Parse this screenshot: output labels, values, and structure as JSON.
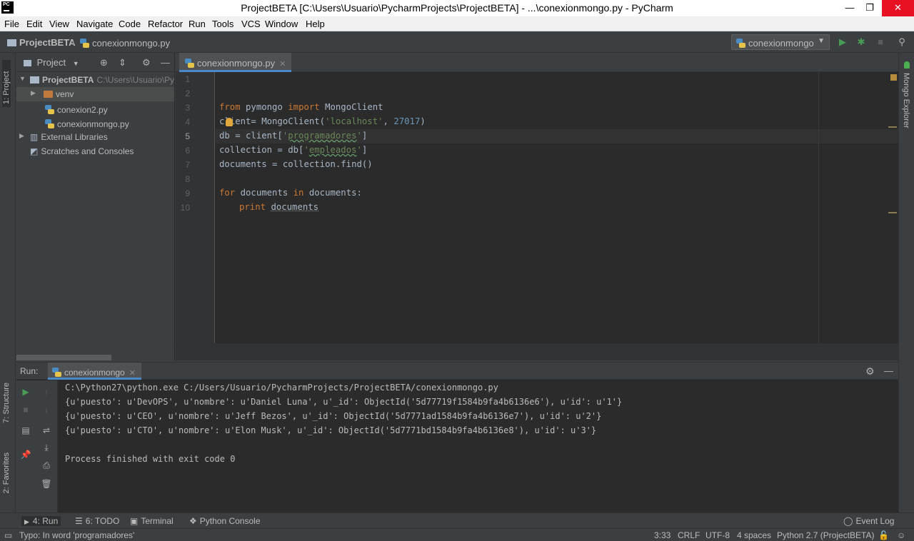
{
  "window": {
    "title": "ProjectBETA [C:\\Users\\Usuario\\PycharmProjects\\ProjectBETA] - ...\\conexionmongo.py - PyCharm",
    "logo_text": "PC",
    "minimize": "—",
    "maximize": "❐",
    "close": "✕"
  },
  "menu": [
    "File",
    "Edit",
    "View",
    "Navigate",
    "Code",
    "Refactor",
    "Run",
    "Tools",
    "VCS",
    "Window",
    "Help"
  ],
  "breadcrumb": {
    "project": "ProjectBETA",
    "file": "conexionmongo.py"
  },
  "run_config": {
    "name": "conexionmongo"
  },
  "left_strip": {
    "project": "1: Project",
    "structure": "7: Structure",
    "favorites": "2: Favorites"
  },
  "right_strip": {
    "mongo": "Mongo Explorer"
  },
  "project_panel": {
    "title": "Project",
    "tree": [
      {
        "label": "ProjectBETA",
        "path": "C:\\Users\\Usuario\\PycharmProjects\\ProjectBETA"
      },
      {
        "label": "venv"
      },
      {
        "label": "conexion2.py"
      },
      {
        "label": "conexionmongo.py"
      },
      {
        "label": "External Libraries"
      },
      {
        "label": "Scratches and Consoles"
      }
    ]
  },
  "editor": {
    "tab": "conexionmongo.py",
    "line_numbers": [
      "1",
      "2",
      "3",
      "4",
      "5",
      "6",
      "7",
      "8",
      "9",
      "10"
    ],
    "code": {
      "l3": {
        "kw1": "from",
        "mod": " pymongo ",
        "kw2": "import",
        "rest": " MongoClient"
      },
      "l4": {
        "a": "client= MongoClient(",
        "s": "'localhost'",
        "b": ", ",
        "n": "27017",
        "c": ")"
      },
      "l5": {
        "a": "db = client[",
        "q1": "'",
        "s": "programadores",
        "q2": "'",
        "c": "]"
      },
      "l6": {
        "a": "collection = db[",
        "q1": "'",
        "s": "empleados",
        "q2": "'",
        "c": "]"
      },
      "l7": "documents = collection.find()",
      "l9": {
        "kw1": "for",
        "a": " documents ",
        "kw2": "in",
        "b": " documents:"
      },
      "l10": {
        "kw": "print",
        "a": " ",
        "b": "documents"
      }
    }
  },
  "run_panel": {
    "label": "Run:",
    "tab": "conexionmongo",
    "output": [
      "C:\\Python27\\python.exe C:/Users/Usuario/PycharmProjects/ProjectBETA/conexionmongo.py",
      "{u'puesto': u'DevOPS', u'nombre': u'Daniel Luna', u'_id': ObjectId('5d77719f1584b9fa4b6136e6'), u'id': u'1'}",
      "{u'puesto': u'CEO', u'nombre': u'Jeff Bezos', u'_id': ObjectId('5d7771ad1584b9fa4b6136e7'), u'id': u'2'}",
      "{u'puesto': u'CTO', u'nombre': u'Elon Musk', u'_id': ObjectId('5d7771bd1584b9fa4b6136e8'), u'id': u'3'}",
      "",
      "Process finished with exit code 0"
    ]
  },
  "bottom_tools": {
    "run": "4: Run",
    "todo": "6: TODO",
    "terminal": "Terminal",
    "python_console": "Python Console",
    "event_log": "Event Log"
  },
  "status": {
    "message": "Typo: In word 'programadores'",
    "position": "3:33",
    "line_sep": "CRLF",
    "encoding": "UTF-8",
    "indent": "4 spaces",
    "interpreter": "Python 2.7 (ProjectBETA)"
  }
}
